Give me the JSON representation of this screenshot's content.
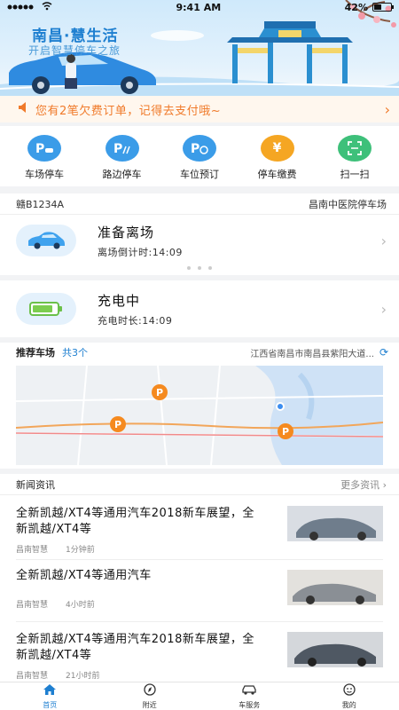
{
  "status": {
    "time": "9:41 AM",
    "battery": "42%",
    "battery_level": 0.42
  },
  "banner": {
    "title": "南昌·慧生活",
    "subtitle": "开启智慧停车之旅"
  },
  "notice": {
    "text": "您有2笔欠费订单，记得去支付哦~"
  },
  "quick": [
    {
      "label": "车场停车",
      "icon": "parking-car-icon",
      "glyph": "P",
      "color": "#3b9ce8"
    },
    {
      "label": "路边停车",
      "icon": "roadside-parking-icon",
      "glyph": "P",
      "color": "#3b9ce8"
    },
    {
      "label": "车位预订",
      "icon": "parking-reserve-icon",
      "glyph": "P",
      "color": "#3b9ce8"
    },
    {
      "label": "停车缴费",
      "icon": "payment-yen-icon",
      "glyph": "¥",
      "color": "#f5a623"
    },
    {
      "label": "扫一扫",
      "icon": "scan-icon",
      "glyph": "⌗",
      "color": "#3ec07a"
    }
  ],
  "parking_card": {
    "plate": "赣B1234A",
    "lot": "昌南中医院停车场",
    "title": "准备离场",
    "countdown": "离场倒计时:14:09"
  },
  "charging_card": {
    "title": "充电中",
    "duration": "充电时长:14:09"
  },
  "recommend": {
    "title": "推荐车场",
    "count": "共3个",
    "address": "江西省南昌市南昌县紫阳大道..."
  },
  "news": {
    "title": "新闻资讯",
    "more": "更多资讯",
    "items": [
      {
        "headline": "全新凯越/XT4等通用汽车2018新车展望，全新凯越/XT4等",
        "source": "昌南智慧",
        "time": "1分钟前"
      },
      {
        "headline": "全新凯越/XT4等通用汽车",
        "source": "昌南智慧",
        "time": "4小时前"
      },
      {
        "headline": "全新凯越/XT4等通用汽车2018新车展望，全新凯越/XT4等",
        "source": "昌南智慧",
        "time": "21小时前"
      }
    ]
  },
  "tabs": [
    {
      "label": "首页",
      "icon": "home-icon"
    },
    {
      "label": "附近",
      "icon": "compass-icon"
    },
    {
      "label": "车服务",
      "icon": "car-service-icon"
    },
    {
      "label": "我的",
      "icon": "profile-icon"
    }
  ],
  "colors": {
    "accent": "#1e7fd0",
    "notice": "#f07a2a"
  }
}
